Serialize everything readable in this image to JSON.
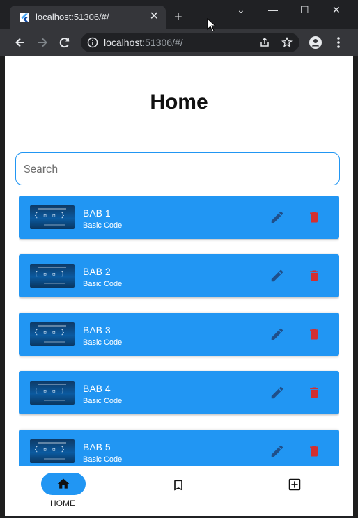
{
  "browser": {
    "tab_title": "localhost:51306/#/",
    "new_tab_glyph": "+",
    "tab_close_glyph": "✕",
    "url_host": "localhost",
    "url_rest": ":51306/#/",
    "window_buttons": [
      "⌄",
      "—",
      "☐",
      "✕"
    ]
  },
  "page": {
    "title": "Home",
    "search_placeholder": "Search"
  },
  "items": [
    {
      "title": "BAB 1",
      "subtitle": "Basic Code"
    },
    {
      "title": "BAB 2",
      "subtitle": "Basic Code"
    },
    {
      "title": "BAB 3",
      "subtitle": "Basic Code"
    },
    {
      "title": "BAB 4",
      "subtitle": "Basic Code"
    },
    {
      "title": "BAB 5",
      "subtitle": "Basic Code"
    }
  ],
  "thumbnail_code": "{ ▫ ▫ }",
  "bottom_nav": {
    "home_label": "HOME"
  },
  "colors": {
    "accent": "#2196f3",
    "edit_icon": "#1f4f8a",
    "delete_icon": "#d32f2f"
  },
  "icons": {
    "item_edit": "pencil-icon",
    "item_delete": "trash-icon",
    "nav_home": "home-icon",
    "nav_bookmark": "bookmark-icon",
    "nav_add": "add-box-icon"
  }
}
